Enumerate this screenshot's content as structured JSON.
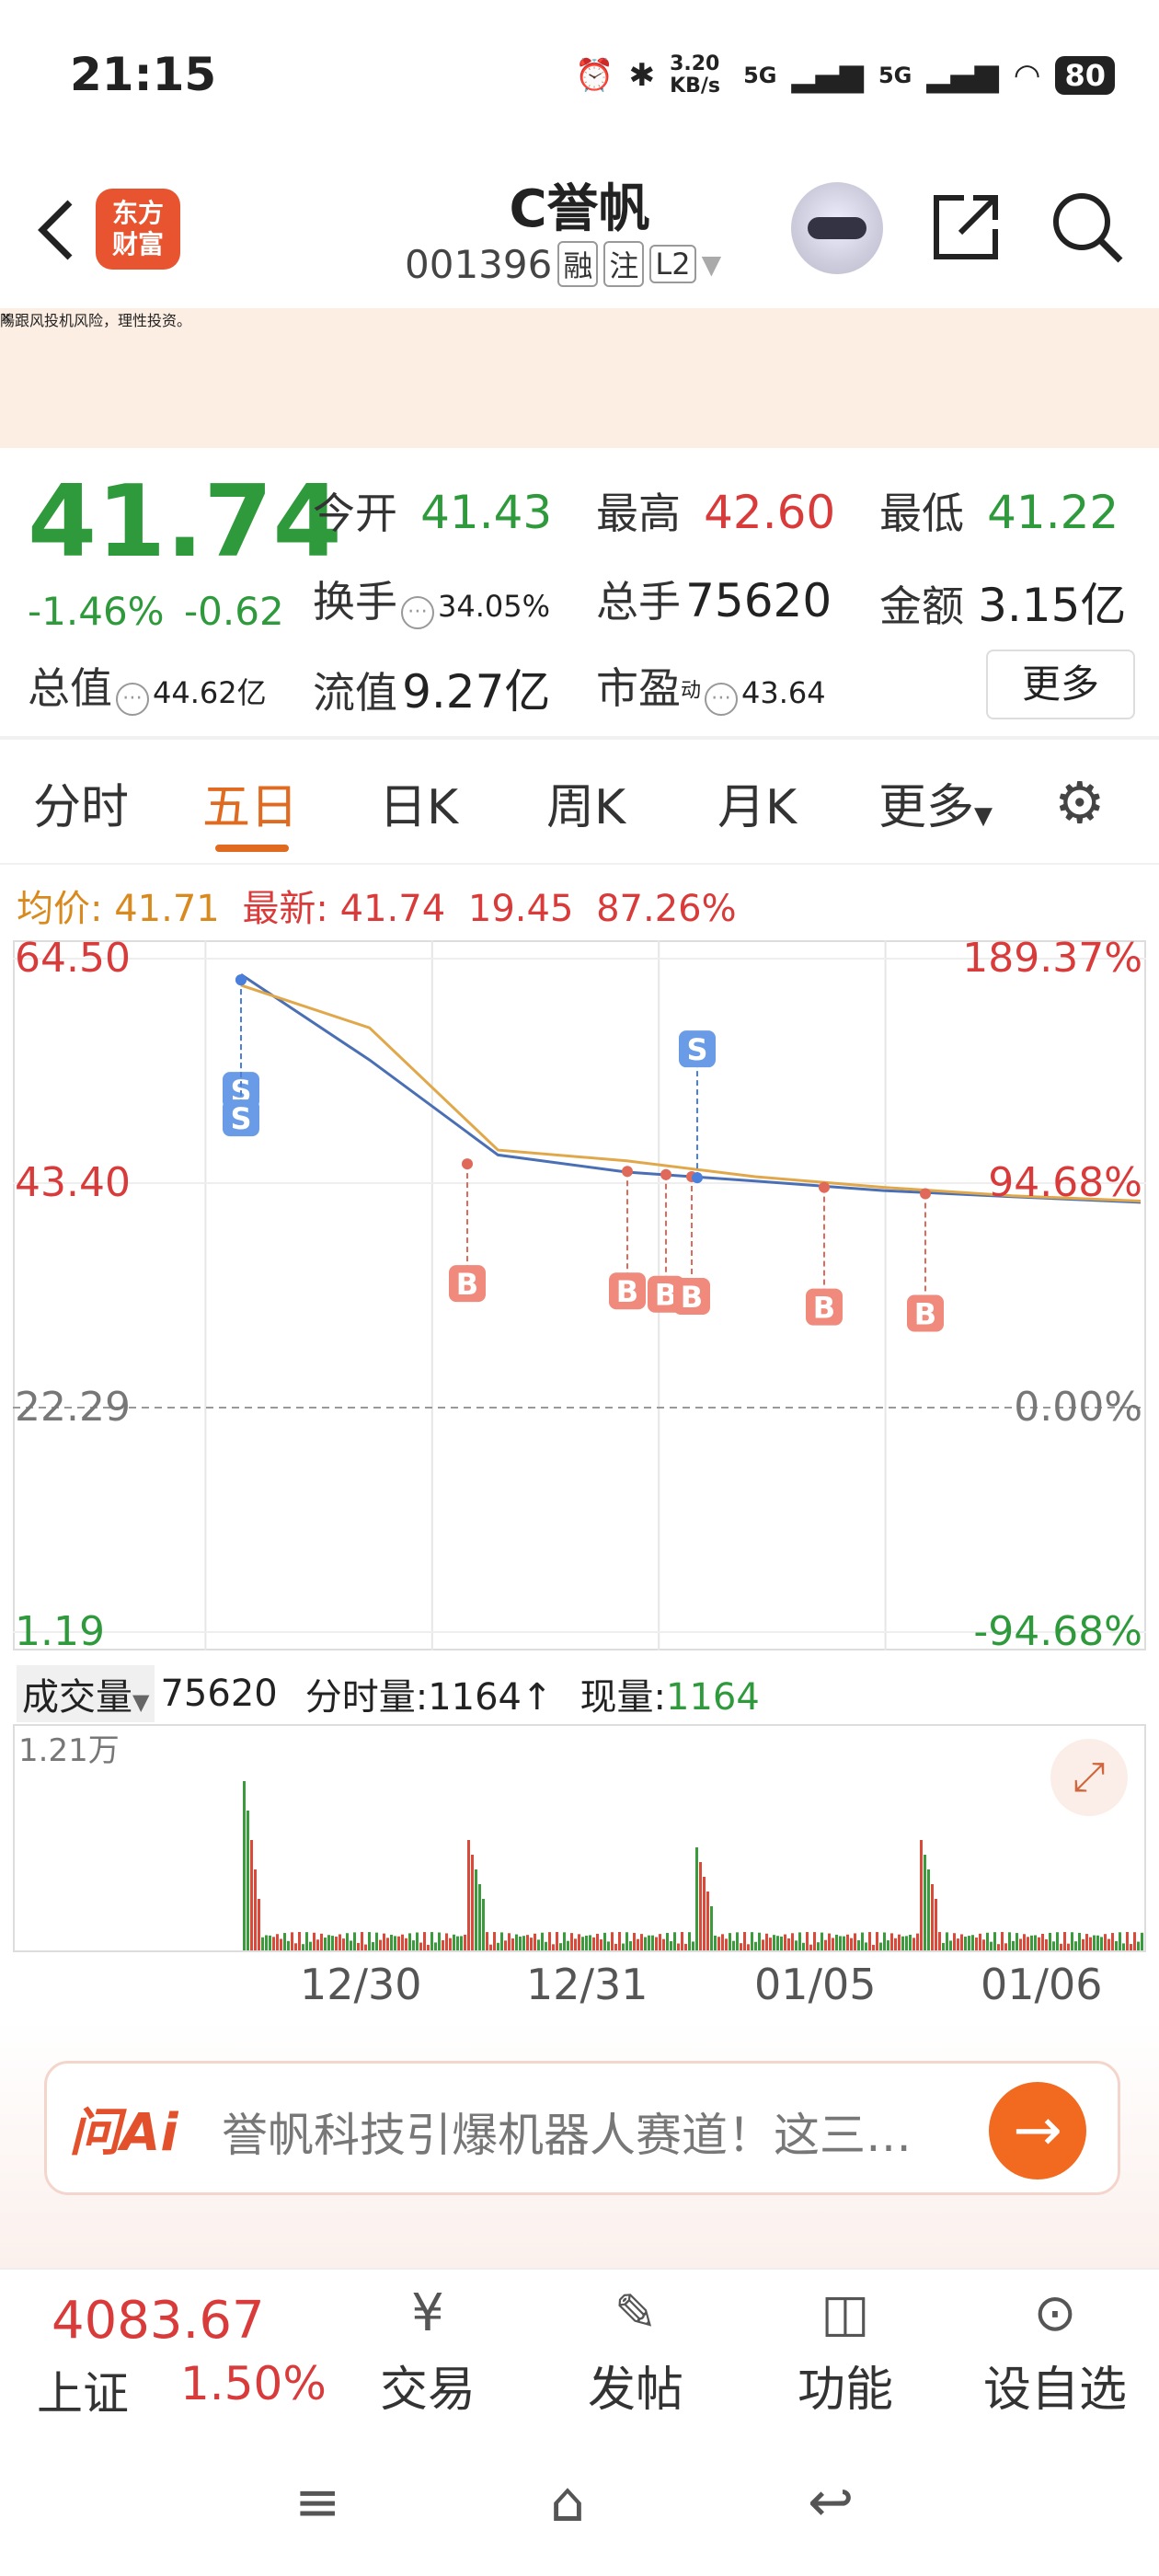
{
  "status": {
    "time": "21:15",
    "net_speed": "3.20 KB/s",
    "sig1": "5G",
    "sig2": "5G",
    "battery": "80"
  },
  "header": {
    "title": "C誉帆",
    "code": "001396",
    "tags": [
      "融",
      "注",
      "L2"
    ],
    "logo_line1": "东方",
    "logo_line2": "财富"
  },
  "notice": {
    "text": "陽跟风投机风险，理性投资。",
    "close": "×"
  },
  "quote": {
    "price": "41.74",
    "pct": "-1.46%",
    "chg": "-0.62",
    "open_label": "今开",
    "open": "41.43",
    "high_label": "最高",
    "high": "42.60",
    "low_label": "最低",
    "low": "41.22",
    "turnover_label": "换手",
    "turnover": "34.05%",
    "vol_label": "总手",
    "vol": "75620",
    "amt_label": "金额",
    "amt": "3.15亿",
    "mcap_label": "总值",
    "mcap": "44.62亿",
    "float_label": "流值",
    "float": "9.27亿",
    "pe_label": "市盈",
    "pe_sup": "动",
    "pe": "43.64",
    "more": "更多"
  },
  "tabs": [
    "分时",
    "五日",
    "日K",
    "周K",
    "月K",
    "更多"
  ],
  "chart_info": {
    "avg_label": "均价:",
    "avg": "41.71",
    "last_label": "最新:",
    "last": "41.74",
    "chg": "19.45",
    "pct": "87.26%"
  },
  "chart_data": {
    "type": "line",
    "x": [
      "12/30",
      "12/31",
      "01/05",
      "01/06"
    ],
    "y_left_ticks": [
      "64.50",
      "43.40",
      "22.29",
      "1.19"
    ],
    "y_right_ticks": [
      "189.37%",
      "94.68%",
      "0.00%",
      "-94.68%"
    ],
    "ylim": [
      1.19,
      64.5
    ],
    "series": [
      {
        "name": "",
        "values": [
          63.0,
          55.0,
          46.0,
          44.5,
          43.5,
          42.8,
          42.0,
          41.74
        ]
      },
      {
        "name": "均价",
        "values": [
          62.0,
          58.0,
          46.5,
          45.5,
          44.0,
          43.0,
          42.2,
          41.71
        ]
      }
    ],
    "markers": [
      "S",
      "S",
      "B",
      "B",
      "B",
      "B",
      "B",
      "B",
      "S"
    ],
    "volume_max_label": "1.21万"
  },
  "volume": {
    "label": "成交量",
    "total": "75620",
    "tick_label": "分时量:1164",
    "tick_arrow": "↑",
    "now_label": "现量:",
    "now": "1164"
  },
  "ai": {
    "brand": "问Ai",
    "text": "誉帆科技引爆机器人赛道！这三…",
    "go": "→"
  },
  "bottom": {
    "index_val": "4083.67",
    "index_name": "上证",
    "index_pct": "1.50%",
    "items": [
      "交易",
      "发帖",
      "功能",
      "设自选"
    ]
  },
  "nav": [
    "≡",
    "⌂",
    "↩"
  ]
}
